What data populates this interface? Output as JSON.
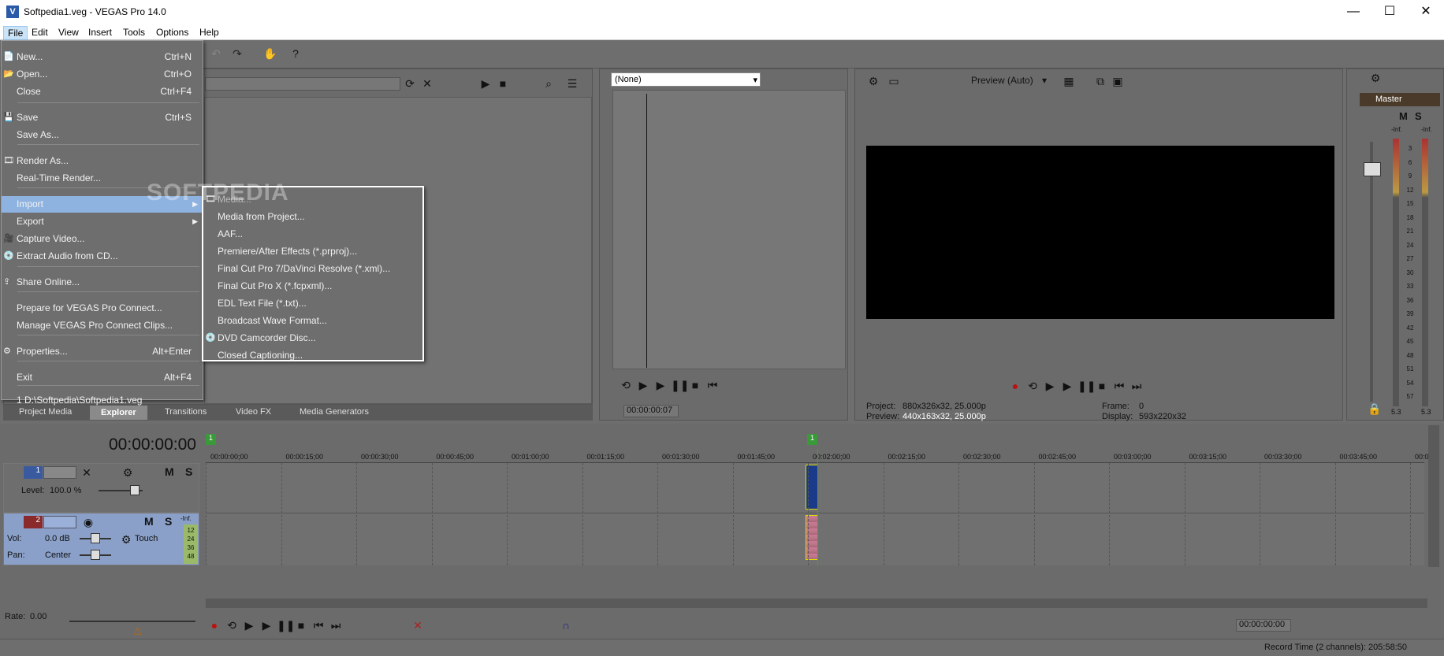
{
  "window": {
    "title": "Softpedia1.veg - VEGAS Pro 14.0",
    "min": "—",
    "max": "☐",
    "close": "✕"
  },
  "menubar": [
    "File",
    "Edit",
    "View",
    "Insert",
    "Tools",
    "Options",
    "Help"
  ],
  "file_menu": {
    "items": [
      {
        "label": "New...",
        "shortcut": "Ctrl+N"
      },
      {
        "label": "Open...",
        "shortcut": "Ctrl+O"
      },
      {
        "label": "Close",
        "shortcut": "Ctrl+F4"
      },
      {
        "label": "Save",
        "shortcut": "Ctrl+S"
      },
      {
        "label": "Save As...",
        "shortcut": ""
      },
      {
        "label": "Render As...",
        "shortcut": ""
      },
      {
        "label": "Real-Time Render...",
        "shortcut": ""
      },
      {
        "label": "Import",
        "shortcut": ""
      },
      {
        "label": "Export",
        "shortcut": ""
      },
      {
        "label": "Capture Video...",
        "shortcut": ""
      },
      {
        "label": "Extract Audio from CD...",
        "shortcut": ""
      },
      {
        "label": "Share Online...",
        "shortcut": ""
      },
      {
        "label": "Prepare for VEGAS Pro Connect...",
        "shortcut": ""
      },
      {
        "label": "Manage VEGAS Pro Connect Clips...",
        "shortcut": ""
      },
      {
        "label": "Properties...",
        "shortcut": "Alt+Enter"
      },
      {
        "label": "Exit",
        "shortcut": "Alt+F4"
      },
      {
        "label": "1 D:\\Softpedia\\Softpedia1.veg",
        "shortcut": ""
      }
    ]
  },
  "import_menu": {
    "items": [
      "Media...",
      "Media from Project...",
      "AAF...",
      "Premiere/After Effects (*.prproj)...",
      "Final Cut Pro 7/DaVinci Resolve (*.xml)...",
      "Final Cut Pro X (*.fcpxml)...",
      "EDL Text File (*.txt)...",
      "Broadcast Wave Format...",
      "DVD Camcorder Disc...",
      "Closed Captioning..."
    ]
  },
  "watermark": "SOFTPEDIA",
  "tabs": [
    "Project Media",
    "Explorer",
    "Transitions",
    "Video FX",
    "Media Generators"
  ],
  "trimmer": {
    "dropdown": "(None)",
    "timecode": "00:00:00:07"
  },
  "preview": {
    "mode": "Preview (Auto)",
    "project_label": "Project:",
    "project_value": "880x326x32, 25.000p",
    "preview_label": "Preview:",
    "preview_value": "440x163x32, 25.000p",
    "frame_label": "Frame:",
    "frame_value": "0",
    "display_label": "Display:",
    "display_value": "593x220x32"
  },
  "master": {
    "label": "Master",
    "inf_left": "-Inf.",
    "inf_right": "-Inf.",
    "scale": [
      "3",
      "6",
      "9",
      "12",
      "15",
      "18",
      "21",
      "24",
      "27",
      "30",
      "33",
      "36",
      "39",
      "42",
      "45",
      "48",
      "51",
      "54",
      "57"
    ],
    "peak_left": "5.3",
    "peak_right": "5.3",
    "m": "M",
    "s": "S"
  },
  "timeline": {
    "timecode": "00:00:00:00",
    "marker": "1",
    "ruler": [
      "00:00:00;00",
      "00:00:15;00",
      "00:00:30;00",
      "00:00:45;00",
      "00:01:00;00",
      "00:01:15;00",
      "00:01:30;00",
      "00:01:45;00",
      "00:02:00;00",
      "00:02:15;00",
      "00:02:30;00",
      "00:02:45;00",
      "00:03:00;00",
      "00:03:15;00",
      "00:03:30;00",
      "00:03:45;00",
      "00:0"
    ],
    "video_track": {
      "number": "1",
      "level_label": "Level:",
      "level": "100.0 %",
      "m": "M",
      "s": "S"
    },
    "audio_track": {
      "number": "2",
      "vol_label": "Vol:",
      "vol": "0.0 dB",
      "pan_label": "Pan:",
      "pan": "Center",
      "mode": "Touch",
      "inf": "-Inf.",
      "meter": [
        "12",
        "24",
        "36",
        "48"
      ],
      "m": "M",
      "s": "S"
    }
  },
  "status": {
    "rate_label": "Rate:",
    "rate": "0.00",
    "cursor_time": "00:00:00:00",
    "record_time": "Record Time (2 channels): 205:58:50"
  }
}
